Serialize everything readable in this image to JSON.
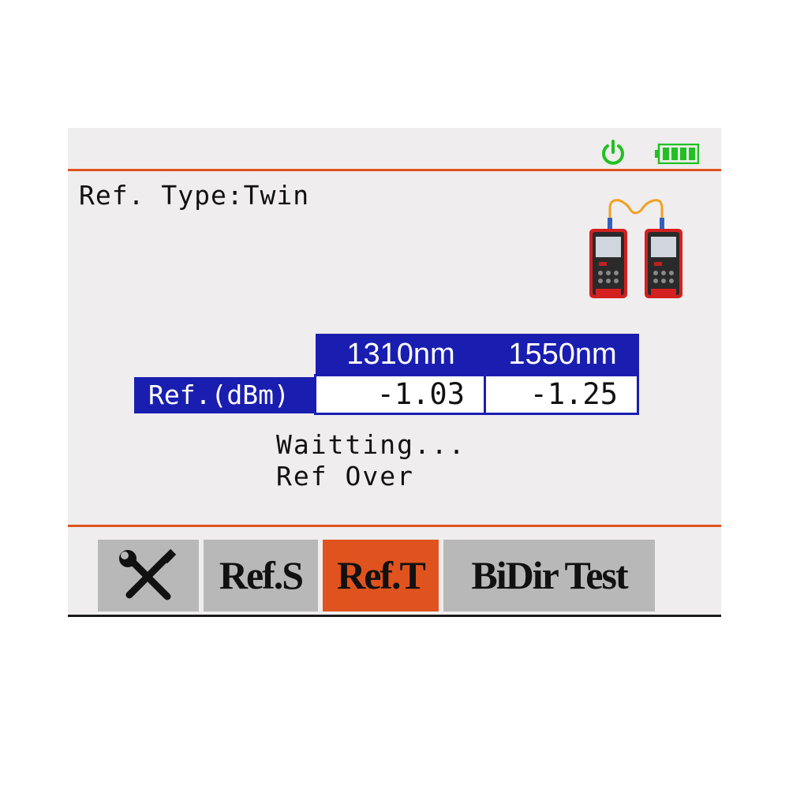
{
  "header": {
    "power_icon": "power-icon",
    "battery_icon": "battery-full-icon",
    "status_color": "#22c022",
    "accent_color": "#e0531f"
  },
  "ref_type_text": "Ref. Type:Twin",
  "illustration": "two-power-meters-with-fiber-jumper",
  "table": {
    "columns": [
      "1310nm",
      "1550nm"
    ],
    "row_label": "Ref.(dBm)",
    "values": [
      "-1.03",
      "-1.25"
    ],
    "header_color": "#1a1eb0"
  },
  "status_lines": [
    "Waitting...",
    "Ref Over"
  ],
  "softkeys": {
    "tools_icon": "wrench-screwdriver-icon",
    "ref_s": "Ref.S",
    "ref_t": "Ref.T",
    "bidir": "BiDir Test",
    "active": "Ref.T"
  }
}
